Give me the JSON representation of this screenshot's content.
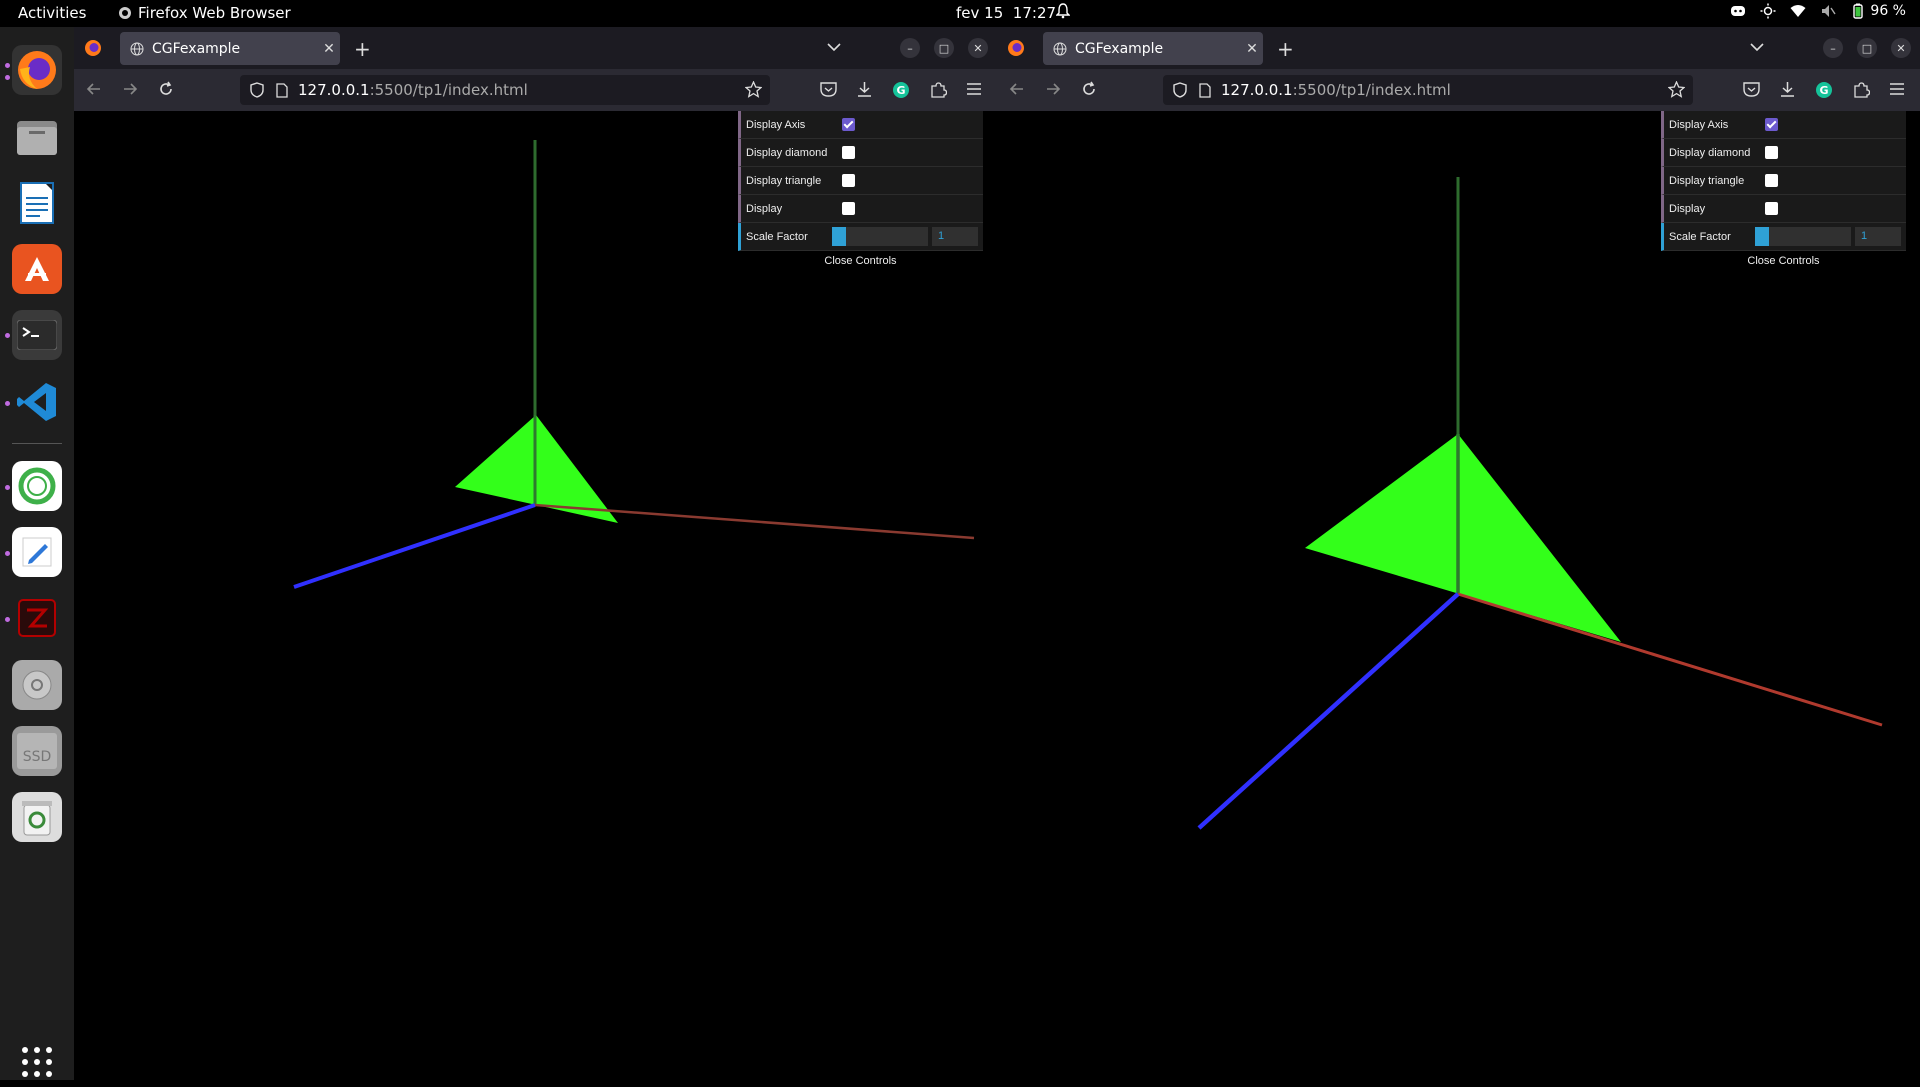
{
  "topbar": {
    "activities": "Activities",
    "app_name": "Firefox Web Browser",
    "date": "fev 15",
    "time": "17:27",
    "battery": "96 %"
  },
  "dock": {
    "items": [
      "firefox",
      "files",
      "libreoffice-writer",
      "app-center",
      "terminal",
      "vscode",
      "anaconda",
      "text-editor",
      "filezilla",
      "disk",
      "ssd",
      "trash"
    ],
    "show_apps": "show-applications"
  },
  "browsers": [
    {
      "tab_title": "CGFexample",
      "url_host": "127.0.0.1",
      "url_path": ":5500/tp1/index.html",
      "gui": {
        "rows": [
          {
            "label": "Display Axis",
            "checked": true
          },
          {
            "label": "Display diamond",
            "checked": false
          },
          {
            "label": "Display triangle",
            "checked": false
          },
          {
            "label": "Display",
            "checked": false
          }
        ],
        "scale_label": "Scale Factor",
        "scale_value": "1",
        "scale_fraction": 0.15,
        "close_label": "Close Controls"
      }
    },
    {
      "tab_title": "CGFexample",
      "url_host": "127.0.0.1",
      "url_path": ":5500/tp1/index.html",
      "gui": {
        "rows": [
          {
            "label": "Display Axis",
            "checked": true
          },
          {
            "label": "Display diamond",
            "checked": false
          },
          {
            "label": "Display triangle",
            "checked": false
          },
          {
            "label": "Display",
            "checked": false
          }
        ],
        "scale_label": "Scale Factor",
        "scale_value": "1",
        "scale_fraction": 0.15,
        "close_label": "Close Controls"
      }
    }
  ],
  "colors": {
    "triangle": "#33ff1a",
    "x_axis": "#c0392b",
    "y_axis": "#2e6b2e",
    "z_axis": "#3030ff"
  }
}
